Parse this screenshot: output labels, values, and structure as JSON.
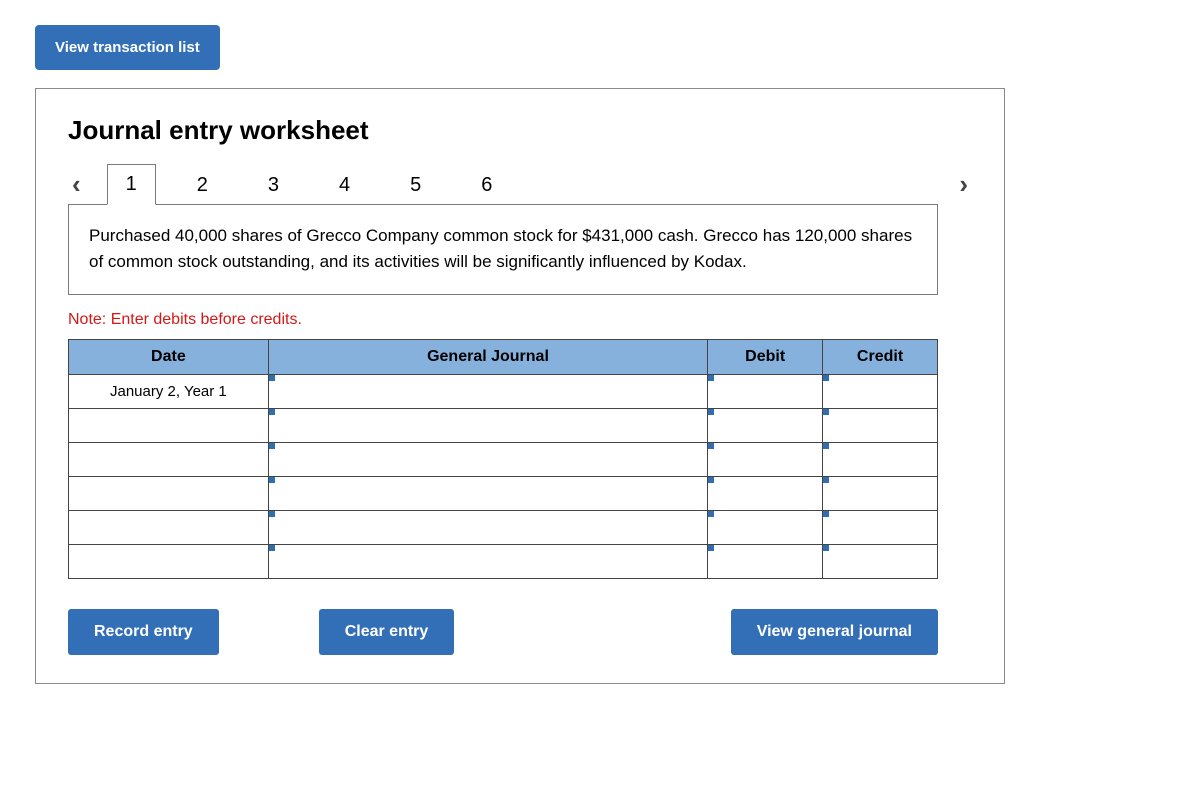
{
  "top_button": "View transaction list",
  "title": "Journal entry worksheet",
  "tabs": [
    "1",
    "2",
    "3",
    "4",
    "5",
    "6"
  ],
  "active_tab_index": 0,
  "description": "Purchased 40,000 shares of Grecco Company common stock for $431,000 cash. Grecco has 120,000 shares of common stock outstanding, and its activities will be significantly influenced by Kodax.",
  "note": "Note: Enter debits before credits.",
  "columns": {
    "date": "Date",
    "gj": "General Journal",
    "debit": "Debit",
    "credit": "Credit"
  },
  "rows": [
    {
      "date": "January 2, Year 1",
      "gj": "",
      "debit": "",
      "credit": ""
    },
    {
      "date": "",
      "gj": "",
      "debit": "",
      "credit": ""
    },
    {
      "date": "",
      "gj": "",
      "debit": "",
      "credit": ""
    },
    {
      "date": "",
      "gj": "",
      "debit": "",
      "credit": ""
    },
    {
      "date": "",
      "gj": "",
      "debit": "",
      "credit": ""
    },
    {
      "date": "",
      "gj": "",
      "debit": "",
      "credit": ""
    }
  ],
  "actions": {
    "record": "Record entry",
    "clear": "Clear entry",
    "view": "View general journal"
  }
}
